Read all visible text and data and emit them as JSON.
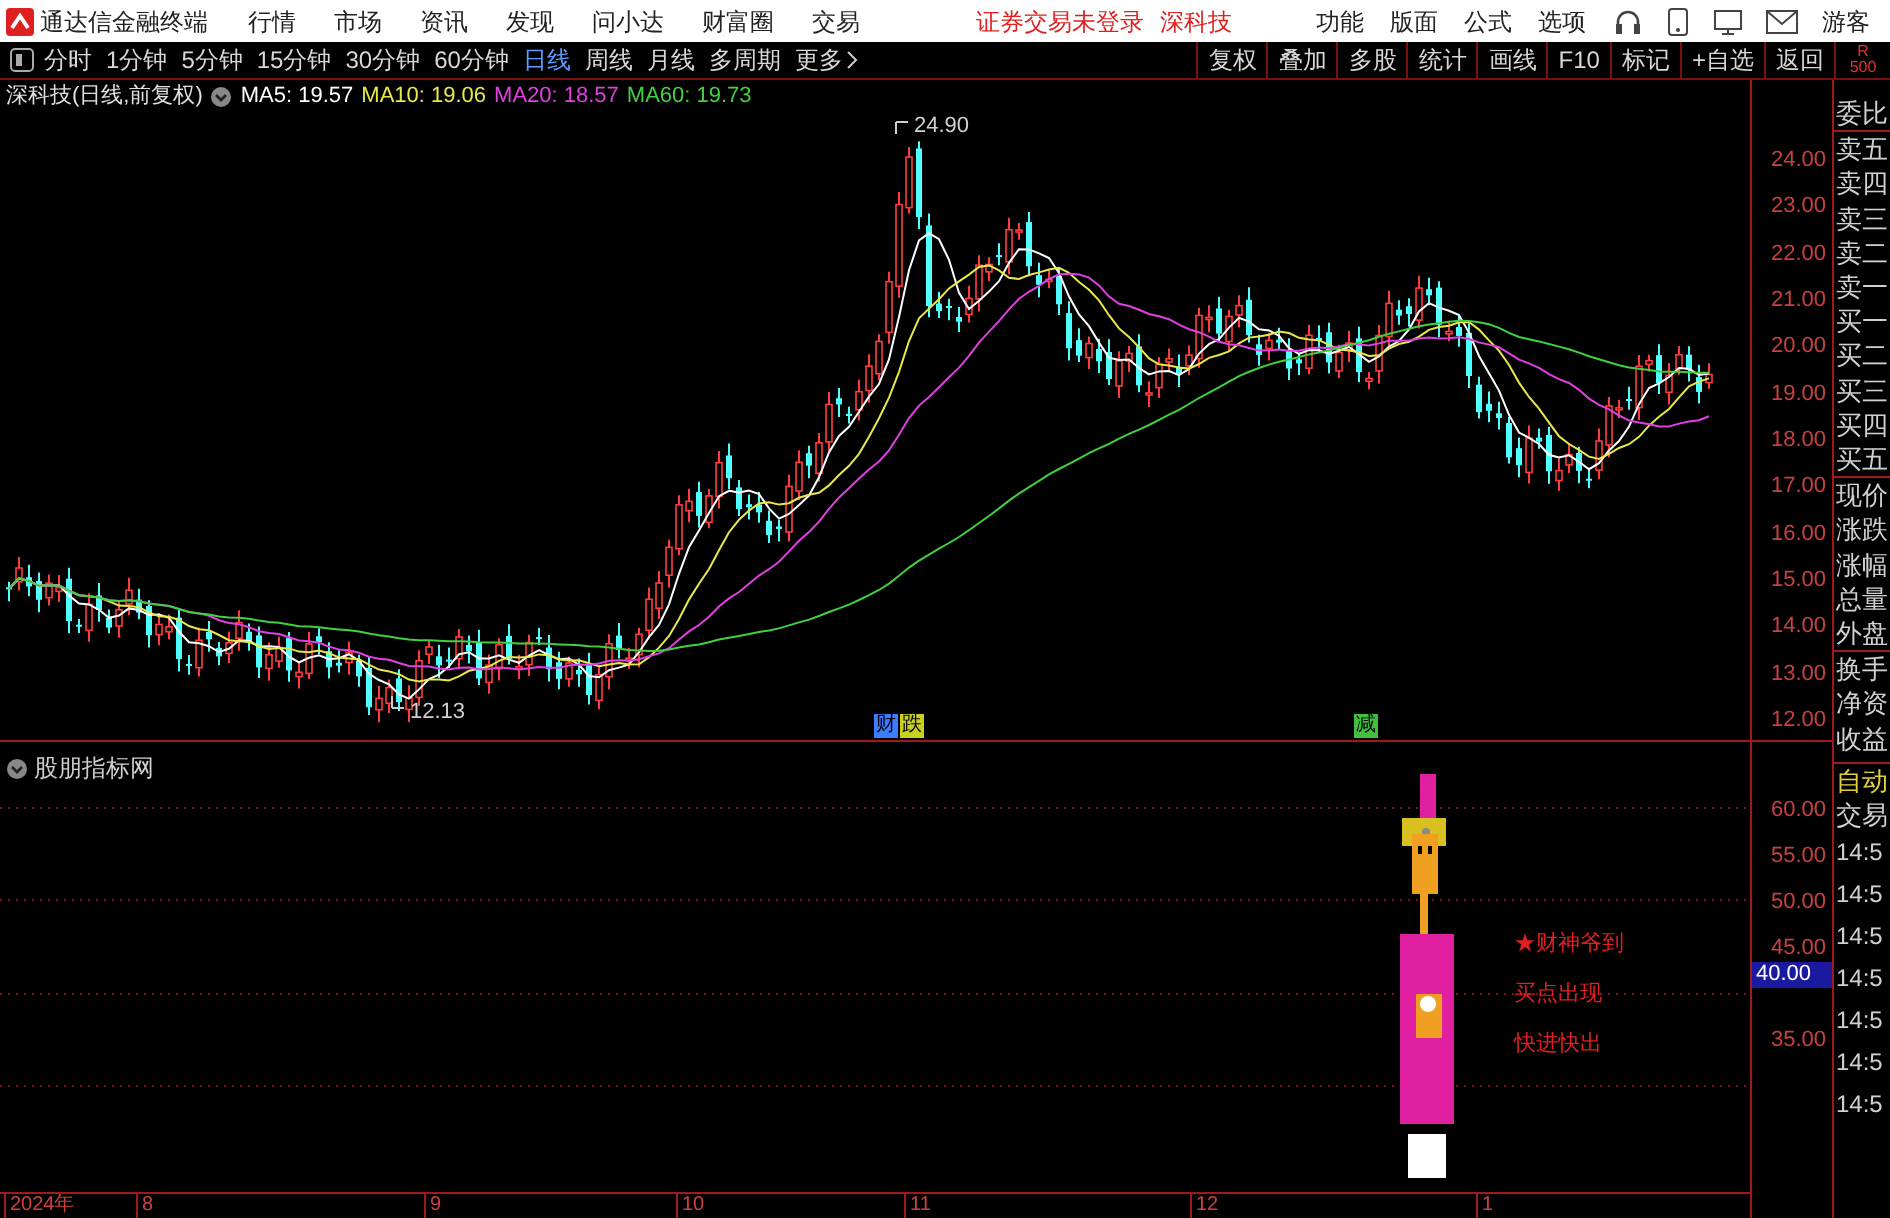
{
  "title_bar": {
    "app_name": "通达信金融终端",
    "menus": [
      "行情",
      "市场",
      "资讯",
      "发现",
      "问小达",
      "财富圈",
      "交易"
    ],
    "login_status": "证券交易未登录",
    "stock": "深科技",
    "tools": [
      "功能",
      "版面",
      "公式",
      "选项"
    ],
    "user": "游客"
  },
  "toolbar": {
    "periods": [
      {
        "label": "分时",
        "selected": false
      },
      {
        "label": "1分钟",
        "selected": false
      },
      {
        "label": "5分钟",
        "selected": false
      },
      {
        "label": "15分钟",
        "selected": false
      },
      {
        "label": "30分钟",
        "selected": false
      },
      {
        "label": "60分钟",
        "selected": false
      },
      {
        "label": "日线",
        "selected": true
      },
      {
        "label": "周线",
        "selected": false
      },
      {
        "label": "月线",
        "selected": false
      },
      {
        "label": "多周期",
        "selected": false
      }
    ],
    "more": "更多",
    "actions": [
      "复权",
      "叠加",
      "多股",
      "统计",
      "画线",
      "F10",
      "标记",
      "+自选",
      "返回"
    ],
    "corner": [
      "R",
      "500"
    ]
  },
  "chart": {
    "title": "深科技(日线,前复权)",
    "ma": [
      {
        "label": "MA5: 19.57",
        "color": "#ffffff"
      },
      {
        "label": "MA10: 19.06",
        "color": "#e8e84a"
      },
      {
        "label": "MA20: 18.57",
        "color": "#e040e0"
      },
      {
        "label": "MA60: 19.73",
        "color": "#40d040"
      }
    ],
    "price_labels": [
      "24.00",
      "23.00",
      "22.00",
      "21.00",
      "20.00",
      "19.00",
      "18.00",
      "17.00",
      "16.00",
      "15.00",
      "14.00",
      "13.00",
      "12.00"
    ],
    "high_label": "24.90",
    "low_label": "12.13",
    "signals": [
      {
        "text": "财",
        "color": "#3a7dff"
      },
      {
        "text": "跌",
        "color": "#c8d020"
      },
      {
        "text": "减",
        "color": "#40c040"
      }
    ]
  },
  "indicator": {
    "title": "股朋指标网",
    "axis_labels": [
      "60.00",
      "55.00",
      "50.00",
      "45.00",
      "35.00"
    ],
    "cursor_value": "40.00",
    "signal_texts": [
      "★财神爷到",
      "买点出现",
      "快进快出"
    ]
  },
  "time_axis": [
    "2024年",
    "8",
    "9",
    "10",
    "11",
    "12",
    "1"
  ],
  "quote_panel": {
    "labels": [
      "委比",
      "卖五",
      "卖四",
      "卖三",
      "卖二",
      "卖一",
      "买一",
      "买二",
      "买三",
      "买四",
      "买五",
      "现价",
      "涨跌",
      "涨幅",
      "总量",
      "外盘",
      "换手",
      "净资",
      "收益"
    ],
    "mode": "自动",
    "section": "交易",
    "times": [
      "14:5",
      "14:5",
      "14:5",
      "14:5",
      "14:5",
      "14:5",
      "14:5"
    ]
  }
}
